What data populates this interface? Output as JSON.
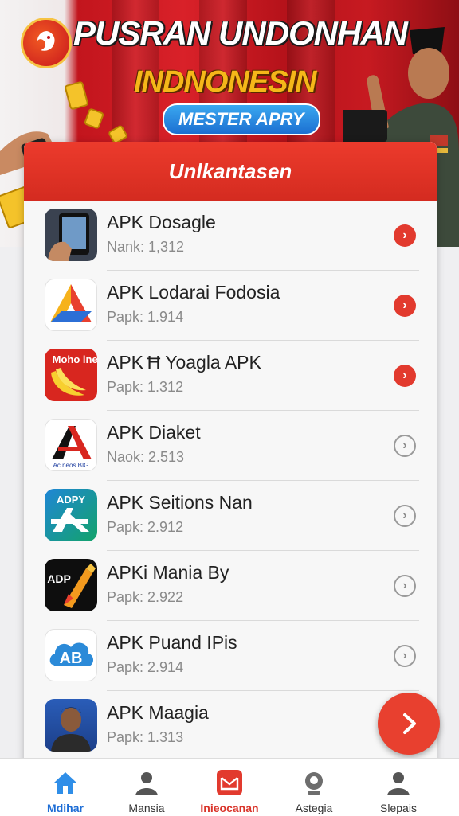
{
  "banner": {
    "title_line1": "PUSRAN UNDONHAN",
    "title_line2": "INDNONESIN",
    "pill": "MESTER APRY"
  },
  "card": {
    "header": "Unlkantasen",
    "items": [
      {
        "name": "APK Dosagle",
        "sub": "Nank: 1,312",
        "action": "red",
        "icon": "tablet-hand-icon"
      },
      {
        "name": "APK Lodarai Fodosia",
        "sub": "Papk: 1.914",
        "action": "red",
        "icon": "triangle-logo-icon"
      },
      {
        "name": "APK Ħ Yoagla APK",
        "sub": "Papk: 1.312",
        "action": "red",
        "icon": "banana-icon",
        "icon_text": "Moho lnei"
      },
      {
        "name": "APK Diaket",
        "sub": "Naok: 2.513",
        "action": "grey",
        "icon": "a-letter-logo-icon",
        "icon_text": "Ac neos BIG"
      },
      {
        "name": "APK Seitions Nan",
        "sub": "Papk: 2.912",
        "action": "grey",
        "icon": "adpy-logo-icon",
        "icon_text": "ADPY"
      },
      {
        "name": "APKi Mania By",
        "sub": "Papk: 2.922",
        "action": "grey",
        "icon": "adp-pen-icon",
        "icon_text": "ADP"
      },
      {
        "name": "APK Puand IPis",
        "sub": "Papk: 2.914",
        "action": "grey",
        "icon": "ab-cloud-icon",
        "icon_text": "AB"
      },
      {
        "name": "APK Maagia",
        "sub": "Papk: 1.313",
        "action": "grey",
        "icon": "person-photo-icon"
      }
    ]
  },
  "nav": [
    {
      "label": "Mdihar",
      "icon": "home-icon"
    },
    {
      "label": "Mansia",
      "icon": "person-icon"
    },
    {
      "label": "Inieocanan",
      "icon": "mail-icon"
    },
    {
      "label": "Astegia",
      "icon": "profile-icon"
    },
    {
      "label": "Slepais",
      "icon": "user-icon"
    }
  ],
  "colors": {
    "accent": "#e23a2e",
    "nav_active": "#1e6ed6"
  }
}
